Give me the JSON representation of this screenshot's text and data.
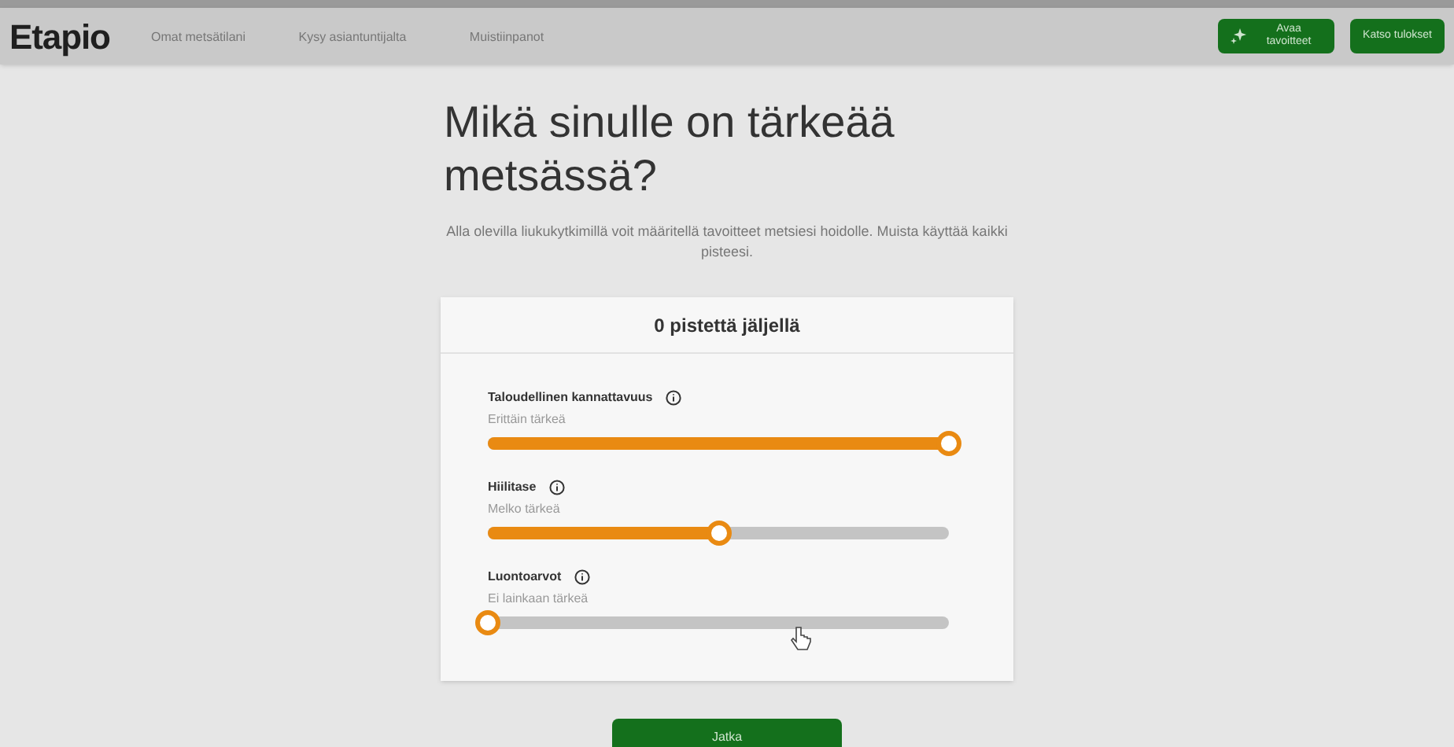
{
  "header": {
    "logo": "Etapio",
    "nav": [
      {
        "label": "Omat metsätilani"
      },
      {
        "label": "Kysy asiantuntijalta"
      },
      {
        "label": "Muistiinpanot"
      }
    ],
    "actions": [
      {
        "label": "Avaa tavoitteet",
        "kind": "icon"
      },
      {
        "label": "Katso tulokset",
        "kind": "plain"
      }
    ]
  },
  "title": "Mikä sinulle on tärkeää metsässä?",
  "intro": "Alla olevilla liukukytkimillä voit määritellä tavoitteet metsiesi hoidolle. Muista käyttää kaikki pisteesi.",
  "card": {
    "heading": "0 pistettä jäljellä",
    "sliders": [
      {
        "name": "Taloudellinen kannattavuus",
        "value": "Erittäin tärkeä",
        "level": 1
      },
      {
        "name": "Hiilitase",
        "value": "Melko tärkeä",
        "level": 0.5
      },
      {
        "name": "Luontoarvot",
        "value": "Ei lainkaan tärkeä",
        "level": 0
      }
    ]
  },
  "continue_button": "Jatka"
}
